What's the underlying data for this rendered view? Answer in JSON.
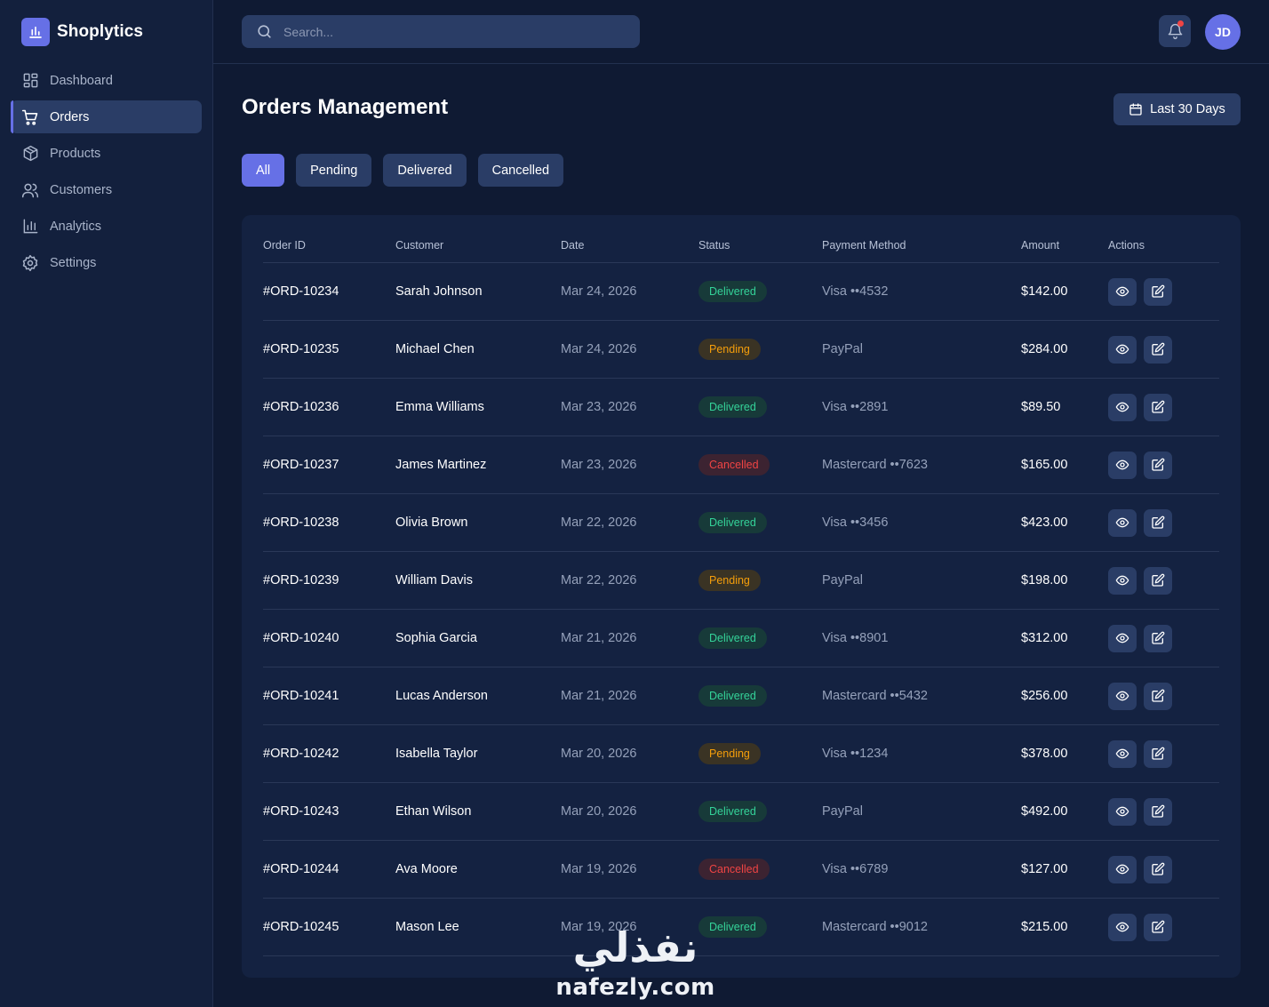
{
  "brand": {
    "name": "Shoplytics",
    "accent": "#6670e6"
  },
  "sidebar": {
    "items": [
      {
        "label": "Dashboard",
        "icon": "dashboard-icon",
        "active": false
      },
      {
        "label": "Orders",
        "icon": "cart-icon",
        "active": true
      },
      {
        "label": "Products",
        "icon": "box-icon",
        "active": false
      },
      {
        "label": "Customers",
        "icon": "users-icon",
        "active": false
      },
      {
        "label": "Analytics",
        "icon": "bar-chart-icon",
        "active": false
      },
      {
        "label": "Settings",
        "icon": "gear-icon",
        "active": false
      }
    ]
  },
  "topbar": {
    "search_placeholder": "Search...",
    "notification_dot_color": "#ef4444",
    "avatar_initials": "JD"
  },
  "main": {
    "title": "Orders Management",
    "date_range_label": "Last 30 Days",
    "filters": [
      {
        "label": "All",
        "active": true
      },
      {
        "label": "Pending",
        "active": false
      },
      {
        "label": "Delivered",
        "active": false
      },
      {
        "label": "Cancelled",
        "active": false
      }
    ]
  },
  "table": {
    "headers": {
      "order_id": "Order ID",
      "customer": "Customer",
      "date": "Date",
      "status": "Status",
      "payment": "Payment Method",
      "amount": "Amount",
      "actions": "Actions"
    },
    "status_colors": {
      "Delivered": "#34d399",
      "Pending": "#f59e0b",
      "Cancelled": "#ef4444"
    },
    "rows": [
      {
        "id": "#ORD-10234",
        "customer": "Sarah Johnson",
        "date": "Mar 24, 2026",
        "status": "Delivered",
        "payment": "Visa ••4532",
        "amount": "$142.00"
      },
      {
        "id": "#ORD-10235",
        "customer": "Michael Chen",
        "date": "Mar 24, 2026",
        "status": "Pending",
        "payment": "PayPal",
        "amount": "$284.00"
      },
      {
        "id": "#ORD-10236",
        "customer": "Emma Williams",
        "date": "Mar 23, 2026",
        "status": "Delivered",
        "payment": "Visa ••2891",
        "amount": "$89.50"
      },
      {
        "id": "#ORD-10237",
        "customer": "James Martinez",
        "date": "Mar 23, 2026",
        "status": "Cancelled",
        "payment": "Mastercard ••7623",
        "amount": "$165.00"
      },
      {
        "id": "#ORD-10238",
        "customer": "Olivia Brown",
        "date": "Mar 22, 2026",
        "status": "Delivered",
        "payment": "Visa ••3456",
        "amount": "$423.00"
      },
      {
        "id": "#ORD-10239",
        "customer": "William Davis",
        "date": "Mar 22, 2026",
        "status": "Pending",
        "payment": "PayPal",
        "amount": "$198.00"
      },
      {
        "id": "#ORD-10240",
        "customer": "Sophia Garcia",
        "date": "Mar 21, 2026",
        "status": "Delivered",
        "payment": "Visa ••8901",
        "amount": "$312.00"
      },
      {
        "id": "#ORD-10241",
        "customer": "Lucas Anderson",
        "date": "Mar 21, 2026",
        "status": "Delivered",
        "payment": "Mastercard ••5432",
        "amount": "$256.00"
      },
      {
        "id": "#ORD-10242",
        "customer": "Isabella Taylor",
        "date": "Mar 20, 2026",
        "status": "Pending",
        "payment": "Visa ••1234",
        "amount": "$378.00"
      },
      {
        "id": "#ORD-10243",
        "customer": "Ethan Wilson",
        "date": "Mar 20, 2026",
        "status": "Delivered",
        "payment": "PayPal",
        "amount": "$492.00"
      },
      {
        "id": "#ORD-10244",
        "customer": "Ava Moore",
        "date": "Mar 19, 2026",
        "status": "Cancelled",
        "payment": "Visa ••6789",
        "amount": "$127.00"
      },
      {
        "id": "#ORD-10245",
        "customer": "Mason Lee",
        "date": "Mar 19, 2026",
        "status": "Delivered",
        "payment": "Mastercard ••9012",
        "amount": "$215.00"
      }
    ],
    "row_action_icons": [
      "eye-icon",
      "edit-icon"
    ]
  },
  "watermark": {
    "arabic": "نفذلي",
    "latin": "nafezly.com"
  }
}
